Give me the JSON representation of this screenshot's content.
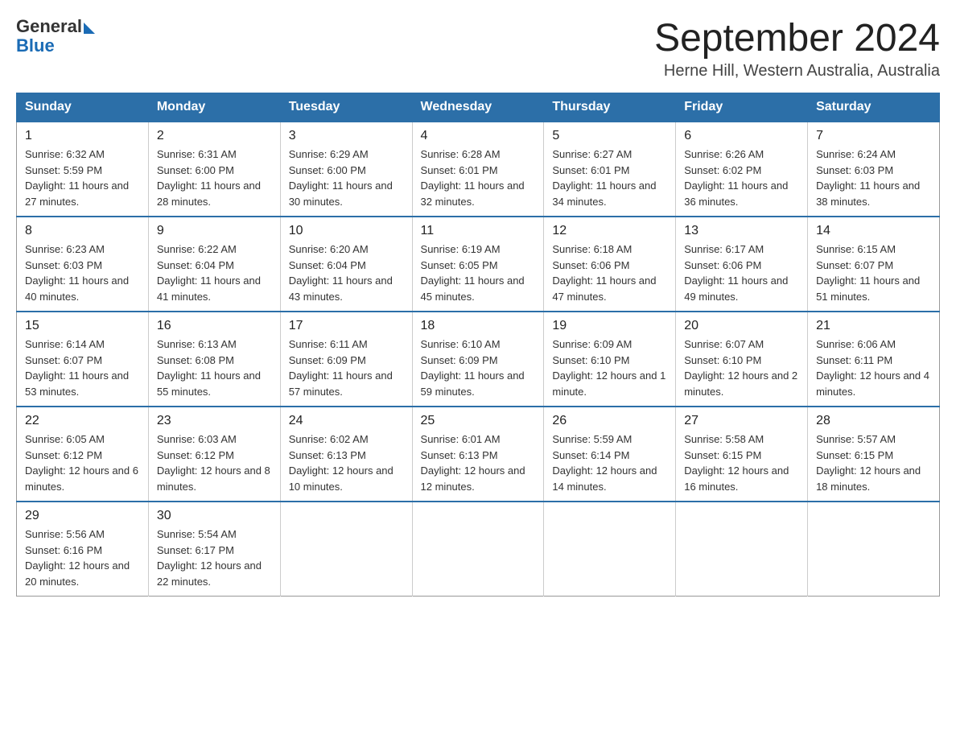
{
  "header": {
    "logo_general": "General",
    "logo_blue": "Blue",
    "month_title": "September 2024",
    "location": "Herne Hill, Western Australia, Australia"
  },
  "calendar": {
    "days_of_week": [
      "Sunday",
      "Monday",
      "Tuesday",
      "Wednesday",
      "Thursday",
      "Friday",
      "Saturday"
    ],
    "weeks": [
      [
        {
          "day": "1",
          "sunrise": "6:32 AM",
          "sunset": "5:59 PM",
          "daylight": "11 hours and 27 minutes."
        },
        {
          "day": "2",
          "sunrise": "6:31 AM",
          "sunset": "6:00 PM",
          "daylight": "11 hours and 28 minutes."
        },
        {
          "day": "3",
          "sunrise": "6:29 AM",
          "sunset": "6:00 PM",
          "daylight": "11 hours and 30 minutes."
        },
        {
          "day": "4",
          "sunrise": "6:28 AM",
          "sunset": "6:01 PM",
          "daylight": "11 hours and 32 minutes."
        },
        {
          "day": "5",
          "sunrise": "6:27 AM",
          "sunset": "6:01 PM",
          "daylight": "11 hours and 34 minutes."
        },
        {
          "day": "6",
          "sunrise": "6:26 AM",
          "sunset": "6:02 PM",
          "daylight": "11 hours and 36 minutes."
        },
        {
          "day": "7",
          "sunrise": "6:24 AM",
          "sunset": "6:03 PM",
          "daylight": "11 hours and 38 minutes."
        }
      ],
      [
        {
          "day": "8",
          "sunrise": "6:23 AM",
          "sunset": "6:03 PM",
          "daylight": "11 hours and 40 minutes."
        },
        {
          "day": "9",
          "sunrise": "6:22 AM",
          "sunset": "6:04 PM",
          "daylight": "11 hours and 41 minutes."
        },
        {
          "day": "10",
          "sunrise": "6:20 AM",
          "sunset": "6:04 PM",
          "daylight": "11 hours and 43 minutes."
        },
        {
          "day": "11",
          "sunrise": "6:19 AM",
          "sunset": "6:05 PM",
          "daylight": "11 hours and 45 minutes."
        },
        {
          "day": "12",
          "sunrise": "6:18 AM",
          "sunset": "6:06 PM",
          "daylight": "11 hours and 47 minutes."
        },
        {
          "day": "13",
          "sunrise": "6:17 AM",
          "sunset": "6:06 PM",
          "daylight": "11 hours and 49 minutes."
        },
        {
          "day": "14",
          "sunrise": "6:15 AM",
          "sunset": "6:07 PM",
          "daylight": "11 hours and 51 minutes."
        }
      ],
      [
        {
          "day": "15",
          "sunrise": "6:14 AM",
          "sunset": "6:07 PM",
          "daylight": "11 hours and 53 minutes."
        },
        {
          "day": "16",
          "sunrise": "6:13 AM",
          "sunset": "6:08 PM",
          "daylight": "11 hours and 55 minutes."
        },
        {
          "day": "17",
          "sunrise": "6:11 AM",
          "sunset": "6:09 PM",
          "daylight": "11 hours and 57 minutes."
        },
        {
          "day": "18",
          "sunrise": "6:10 AM",
          "sunset": "6:09 PM",
          "daylight": "11 hours and 59 minutes."
        },
        {
          "day": "19",
          "sunrise": "6:09 AM",
          "sunset": "6:10 PM",
          "daylight": "12 hours and 1 minute."
        },
        {
          "day": "20",
          "sunrise": "6:07 AM",
          "sunset": "6:10 PM",
          "daylight": "12 hours and 2 minutes."
        },
        {
          "day": "21",
          "sunrise": "6:06 AM",
          "sunset": "6:11 PM",
          "daylight": "12 hours and 4 minutes."
        }
      ],
      [
        {
          "day": "22",
          "sunrise": "6:05 AM",
          "sunset": "6:12 PM",
          "daylight": "12 hours and 6 minutes."
        },
        {
          "day": "23",
          "sunrise": "6:03 AM",
          "sunset": "6:12 PM",
          "daylight": "12 hours and 8 minutes."
        },
        {
          "day": "24",
          "sunrise": "6:02 AM",
          "sunset": "6:13 PM",
          "daylight": "12 hours and 10 minutes."
        },
        {
          "day": "25",
          "sunrise": "6:01 AM",
          "sunset": "6:13 PM",
          "daylight": "12 hours and 12 minutes."
        },
        {
          "day": "26",
          "sunrise": "5:59 AM",
          "sunset": "6:14 PM",
          "daylight": "12 hours and 14 minutes."
        },
        {
          "day": "27",
          "sunrise": "5:58 AM",
          "sunset": "6:15 PM",
          "daylight": "12 hours and 16 minutes."
        },
        {
          "day": "28",
          "sunrise": "5:57 AM",
          "sunset": "6:15 PM",
          "daylight": "12 hours and 18 minutes."
        }
      ],
      [
        {
          "day": "29",
          "sunrise": "5:56 AM",
          "sunset": "6:16 PM",
          "daylight": "12 hours and 20 minutes."
        },
        {
          "day": "30",
          "sunrise": "5:54 AM",
          "sunset": "6:17 PM",
          "daylight": "12 hours and 22 minutes."
        },
        null,
        null,
        null,
        null,
        null
      ]
    ]
  }
}
